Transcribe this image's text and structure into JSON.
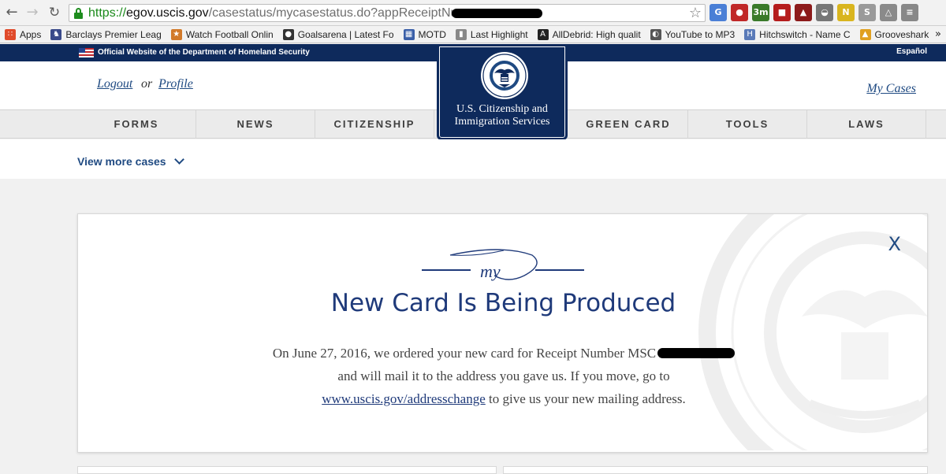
{
  "browser": {
    "url_scheme": "https://",
    "url_host": "egov.uscis.gov",
    "url_path": "/casestatus/mycasestatus.do?appReceiptNum=",
    "extensions": [
      {
        "name": "google-translate-icon",
        "glyph": "G",
        "color": "#4a7fd6"
      },
      {
        "name": "ublock-icon",
        "glyph": "●",
        "color": "#c02828"
      },
      {
        "name": "timer-icon",
        "glyph": "3m",
        "color": "#3a7a2a"
      },
      {
        "name": "pdf-icon",
        "glyph": "■",
        "color": "#b51c1c"
      },
      {
        "name": "hat-icon",
        "glyph": "▲",
        "color": "#8c1a1a"
      },
      {
        "name": "mask-icon",
        "glyph": "◒",
        "color": "#777777"
      },
      {
        "name": "n-icon",
        "glyph": "N",
        "color": "#d9b51e"
      },
      {
        "name": "skype-icon",
        "glyph": "S",
        "color": "#9a9a9a"
      },
      {
        "name": "drive-icon",
        "glyph": "△",
        "color": "#8a8a8a"
      },
      {
        "name": "menu-icon",
        "glyph": "≡",
        "color": "#888888"
      }
    ]
  },
  "bookmarks": [
    {
      "label": "Apps",
      "icon": "apps-grid-icon",
      "color": "#e04a2a",
      "glyph": "∷"
    },
    {
      "label": "Barclays Premier Leag",
      "icon": "lion-icon",
      "color": "#3a4a8a",
      "glyph": "♞"
    },
    {
      "label": "Watch Football Onlin",
      "icon": "football-icon",
      "color": "#d27a2a",
      "glyph": "★"
    },
    {
      "label": "Goalsarena | Latest Fo",
      "icon": "soccer-ball-icon",
      "color": "#333333",
      "glyph": "●"
    },
    {
      "label": "MOTD",
      "icon": "grid-icon",
      "color": "#3a5fa8",
      "glyph": "▦"
    },
    {
      "label": "Last Highlight",
      "icon": "bookmark-icon",
      "color": "#888888",
      "glyph": "▮"
    },
    {
      "label": "AllDebrid: High qualit",
      "icon": "alldebrid-icon",
      "color": "#222222",
      "glyph": "A"
    },
    {
      "label": "YouTube to MP3",
      "icon": "headphones-icon",
      "color": "#555555",
      "glyph": "◐"
    },
    {
      "label": "Hitchswitch - Name C",
      "icon": "hitchswitch-icon",
      "color": "#5a7ab8",
      "glyph": "H"
    },
    {
      "label": "Grooveshark",
      "icon": "grooveshark-icon",
      "color": "#e0a020",
      "glyph": "▲"
    }
  ],
  "dhs_bar": {
    "official_text": "Official Website of the Department of Homeland Security",
    "espanol": "Español"
  },
  "header": {
    "logout": "Logout",
    "or": "or",
    "profile": "Profile",
    "my_cases": "My Cases",
    "logo_line1": "U.S. Citizenship and",
    "logo_line2": "Immigration Services"
  },
  "nav": {
    "items": [
      "FORMS",
      "NEWS",
      "CITIZENSHIP",
      "GREEN CARD",
      "TOOLS",
      "LAWS"
    ]
  },
  "view_more": {
    "label": "View more cases"
  },
  "case": {
    "flourish_text": "my",
    "close": "X",
    "title": "New Card Is Being Produced",
    "body_part1": "On June 27, 2016, we ordered your new card for Receipt Number MSC",
    "body_part2": " and will mail it to the address you gave us. If you move, go to",
    "link": "www.uscis.gov/addresschange",
    "body_part3": " to give us your new mailing address."
  },
  "colors": {
    "navy": "#0e2a5c",
    "link_blue": "#1f4a82",
    "title_blue": "#1f3a7a"
  }
}
